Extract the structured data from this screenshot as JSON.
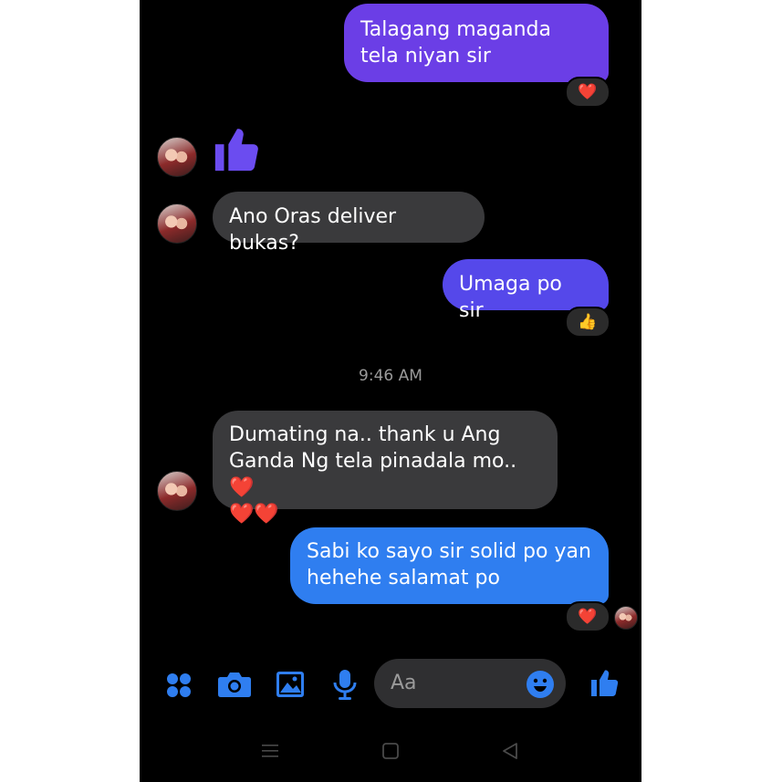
{
  "messages": [
    {
      "id": "m1",
      "text": "Talagang maganda tela niyan sir",
      "reaction": "❤️"
    },
    {
      "id": "m3",
      "text": "Ano Oras deliver bukas?"
    },
    {
      "id": "m4",
      "text": "Umaga po sir",
      "reaction": "👍"
    },
    {
      "id": "m5",
      "text": "Dumating na.. thank u Ang Ganda Ng tela pinadala mo..",
      "emoji_inline": "❤️",
      "emoji_tail": "❤️❤️"
    },
    {
      "id": "m6",
      "text": "Sabi ko sayo sir solid po yan hehehe salamat po",
      "reaction": "❤️"
    }
  ],
  "timestamp": "9:46 AM",
  "composer": {
    "placeholder": "Aa"
  },
  "icons": {
    "apps": "apps-grid-icon",
    "camera": "camera-icon",
    "gallery": "image-icon",
    "mic": "microphone-icon",
    "emoji": "emoji-icon",
    "like": "thumbs-up-icon"
  },
  "colors": {
    "accent": "#2f7ef0",
    "purple": "#6b3ee6",
    "indigo": "#5548ea",
    "incoming": "#3a3a3c"
  }
}
